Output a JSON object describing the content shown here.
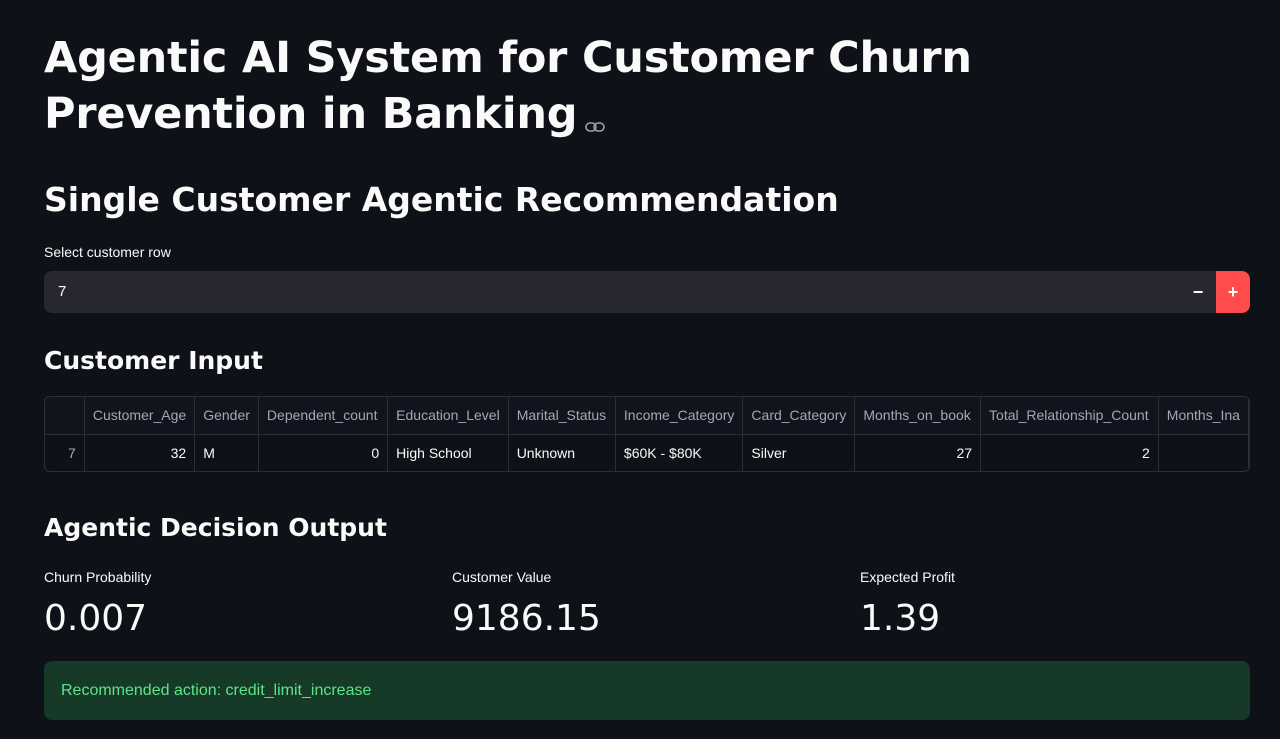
{
  "title": "Agentic AI System for Customer Churn Prevention in Banking",
  "subheader": "Single Customer Agentic Recommendation",
  "selector": {
    "label": "Select customer row",
    "value": "7",
    "minus": "−",
    "plus": "+"
  },
  "customer_input": {
    "header": "Customer Input",
    "columns": [
      "",
      "Customer_Age",
      "Gender",
      "Dependent_count",
      "Education_Level",
      "Marital_Status",
      "Income_Category",
      "Card_Category",
      "Months_on_book",
      "Total_Relationship_Count",
      "Months_Ina"
    ],
    "row": [
      "7",
      "32",
      "M",
      "0",
      "High School",
      "Unknown",
      "$60K - $80K",
      "Silver",
      "27",
      "2",
      ""
    ]
  },
  "decision_output": {
    "header": "Agentic Decision Output",
    "metrics": [
      {
        "label": "Churn Probability",
        "value": "0.007"
      },
      {
        "label": "Customer Value",
        "value": "9186.15"
      },
      {
        "label": "Expected Profit",
        "value": "1.39"
      }
    ],
    "recommendation": "Recommended action: credit_limit_increase"
  },
  "colors": {
    "background": "#0e1117",
    "accent": "#ff4b4b",
    "success_bg": "#173928",
    "success_text": "#5ce488"
  },
  "icons": {
    "anchor": "link-icon"
  }
}
